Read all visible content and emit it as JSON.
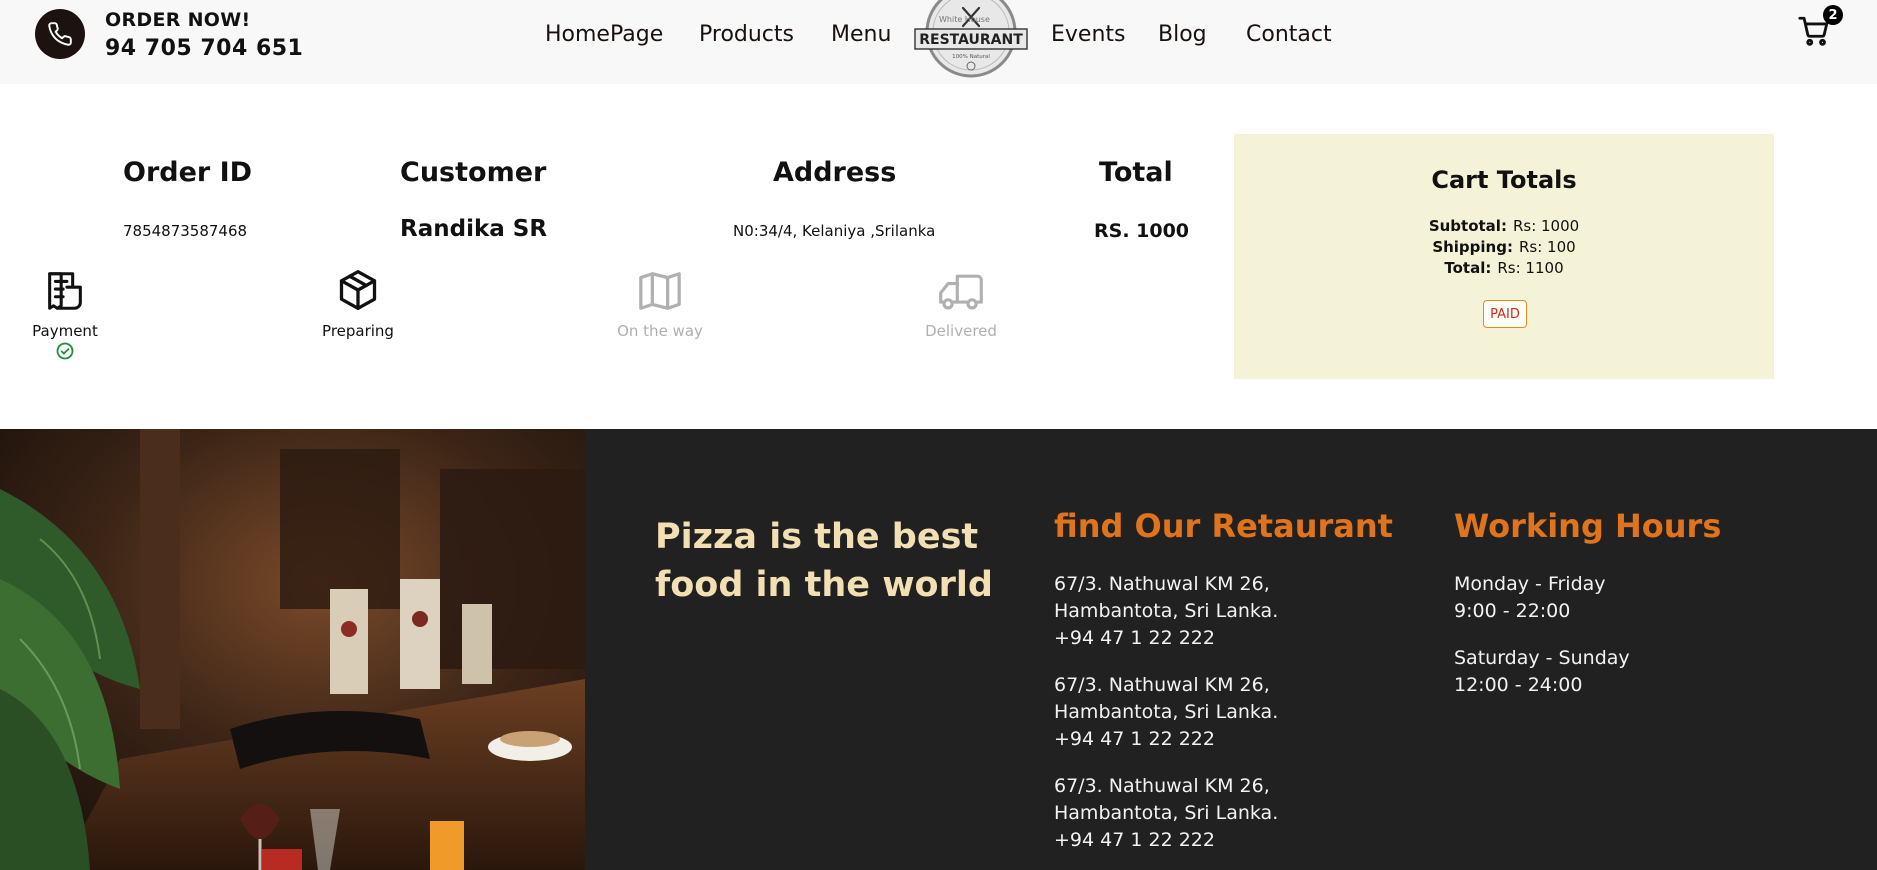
{
  "header": {
    "order_now": "ORDER NOW!",
    "phone": "94 705 704 651",
    "nav": [
      "HomePage",
      "Products",
      "Menu",
      "Events",
      "Blog",
      "Contact"
    ],
    "logo": {
      "top_text": "White House",
      "main_text": "RESTAURANT",
      "bottom_text": "100% Natural"
    },
    "cart_count": "2"
  },
  "order": {
    "headers": {
      "order_id": "Order ID",
      "customer": "Customer",
      "address": "Address",
      "total": "Total"
    },
    "values": {
      "order_id": "7854873587468",
      "customer": "Randika SR",
      "address": "N0:34/4, Kelaniya ,Srilanka",
      "total": "RS. 1000"
    },
    "steps": [
      {
        "label": "Payment",
        "status": "done",
        "icon": "receipt-icon"
      },
      {
        "label": "Preparing",
        "status": "done",
        "icon": "package-icon"
      },
      {
        "label": "On the way",
        "status": "pending",
        "icon": "map-icon"
      },
      {
        "label": "Delivered",
        "status": "pending",
        "icon": "truck-icon"
      }
    ]
  },
  "cart_totals": {
    "title": "Cart Totals",
    "subtotal_label": "Subtotal:",
    "subtotal_value": "Rs: 1000",
    "shipping_label": "Shipping:",
    "shipping_value": "Rs: 100",
    "total_label": "Total:",
    "total_value": "Rs: 1100",
    "status": "PAID"
  },
  "footer": {
    "tagline": "Pizza is the best food in the world",
    "find_heading": "find Our Retaurant",
    "locations": [
      {
        "line1": "67/3. Nathuwal KM 26,",
        "line2": "Hambantota, Sri Lanka.",
        "phone": "+94 47 1 22 222"
      },
      {
        "line1": "67/3. Nathuwal KM 26,",
        "line2": "Hambantota, Sri Lanka.",
        "phone": "+94 47 1 22 222"
      },
      {
        "line1": "67/3. Nathuwal KM 26,",
        "line2": "Hambantota, Sri Lanka.",
        "phone": "+94 47 1 22 222"
      }
    ],
    "hours_heading": "Working Hours",
    "hours": [
      {
        "days": "Monday - Friday",
        "time": "9:00 - 22:00"
      },
      {
        "days": "Saturday - Sunday",
        "time": "12:00 - 24:00"
      }
    ]
  },
  "colors": {
    "navbar_bg": "#f8f8f8",
    "footer_bg": "#212121",
    "cart_totals_bg": "#f4f3d7",
    "accent_orange": "#e0741c",
    "tagline_cream": "#f2dfb3",
    "check_green": "#1e8e3e"
  }
}
